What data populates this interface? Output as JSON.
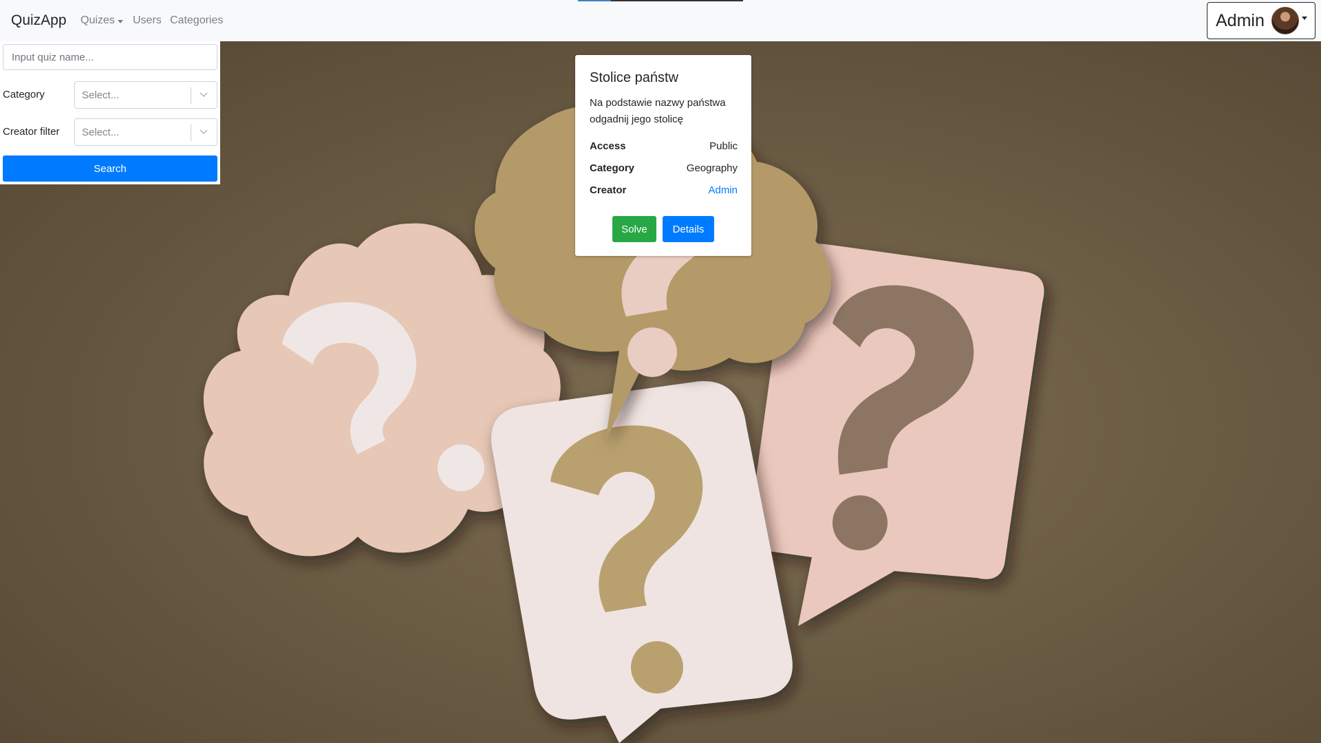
{
  "navbar": {
    "brand": "QuizApp",
    "links": [
      {
        "label": "Quizes",
        "dropdown": true
      },
      {
        "label": "Users"
      },
      {
        "label": "Categories"
      }
    ],
    "user": {
      "name": "Admin"
    }
  },
  "search_panel": {
    "quiz_name_placeholder": "Input quiz name...",
    "category_label": "Category",
    "category_placeholder": "Select...",
    "creator_label": "Creator filter",
    "creator_placeholder": "Select...",
    "search_label": "Search"
  },
  "quiz_card": {
    "title": "Stolice państw",
    "description": "Na podstawie nazwy państwa odgadnij jego stolicę",
    "rows": [
      {
        "label": "Access",
        "value": "Public"
      },
      {
        "label": "Category",
        "value": "Geography"
      },
      {
        "label": "Creator",
        "value": "Admin"
      }
    ],
    "solve_label": "Solve",
    "details_label": "Details"
  },
  "colors": {
    "primary": "#007bff",
    "success": "#28a745",
    "navbar_bg": "#f8f9fa",
    "background": "#6b5c44"
  },
  "background_image": "paper question-mark speech bubbles on brown background"
}
